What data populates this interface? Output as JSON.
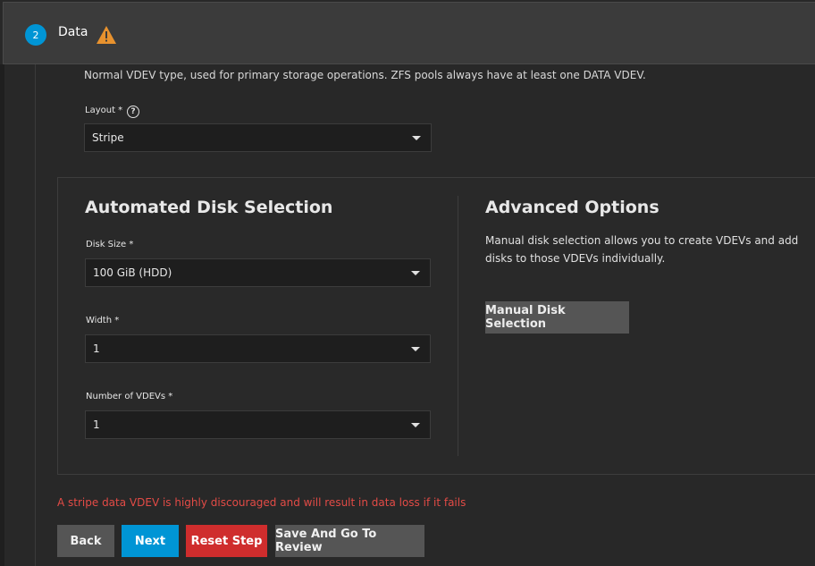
{
  "step": {
    "number": "2",
    "title": "Data"
  },
  "description": "Normal VDEV type, used for primary storage operations. ZFS pools always have at least one DATA VDEV.",
  "layout": {
    "label": "Layout *",
    "help": "?",
    "value": "Stripe"
  },
  "automated": {
    "title": "Automated Disk Selection",
    "disk_size": {
      "label": "Disk Size *",
      "value": "100 GiB (HDD)"
    },
    "width": {
      "label": "Width *",
      "value": "1"
    },
    "num_vdevs": {
      "label": "Number of VDEVs *",
      "value": "1"
    }
  },
  "advanced": {
    "title": "Advanced Options",
    "text": "Manual disk selection allows you to create VDEVs and add disks to those VDEVs individually.",
    "manual_button": "Manual Disk Selection"
  },
  "error": "A stripe data VDEV is highly discouraged and will result in data loss if it fails",
  "buttons": {
    "back": "Back",
    "next": "Next",
    "reset": "Reset Step",
    "review": "Save And Go To Review"
  },
  "colors": {
    "accent": "#0095d5",
    "danger": "#cf2d2d",
    "warning": "#e8922e",
    "error_text": "#e34b46"
  },
  "icons": {
    "step_warning": "warning-icon",
    "layout_help": "help-icon",
    "dropdown": "caret-down-icon"
  }
}
